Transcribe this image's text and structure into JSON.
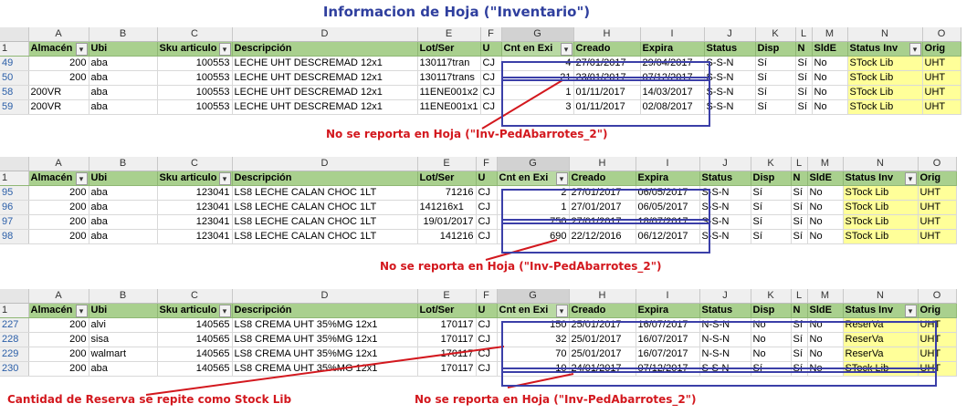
{
  "title": "Informacion de Hoja (\"Inventario\")",
  "column_letters": [
    "A",
    "B",
    "C",
    "D",
    "E",
    "F",
    "G",
    "H",
    "I",
    "J",
    "K",
    "L",
    "M",
    "N",
    "O"
  ],
  "headers": [
    "Almacén",
    "Ubi",
    "Sku articulo",
    "Descripción",
    "Lot/Ser",
    "U",
    "Cnt en Exi",
    "Creado",
    "Expira",
    "Status",
    "Disp",
    "N",
    "SldE",
    "Status Inv",
    "Orig"
  ],
  "headers_variant": [
    "Almacén",
    "Ubi",
    "Sku articulo",
    "Descripción",
    "Lot/Ser",
    "U",
    "Cnt en Exi",
    "Creado",
    "Expira",
    "Status",
    "Disp",
    "N",
    "SldE",
    "Status Inv",
    "Orig"
  ],
  "header_row_number": "1",
  "blocks": [
    {
      "rows": [
        {
          "num": "49",
          "cells": [
            "200",
            "aba",
            "100553",
            "LECHE UHT DESCREMAD 12x1",
            "130117tran",
            "CJ",
            "4",
            "27/01/2017",
            "29/04/2017",
            "S-S-N",
            "Sí",
            "Sí",
            "No",
            "STock Lib",
            "UHT"
          ]
        },
        {
          "num": "50",
          "cells": [
            "200",
            "aba",
            "100553",
            "LECHE UHT DESCREMAD 12x1",
            "130117trans",
            "CJ",
            "21",
            "23/01/2017",
            "07/12/2017",
            "S-S-N",
            "Sí",
            "Sí",
            "No",
            "STock Lib",
            "UHT"
          ]
        },
        {
          "num": "58",
          "cells": [
            "200VR",
            "aba",
            "100553",
            "LECHE UHT DESCREMAD 12x1",
            "11ENE001x2",
            "CJ",
            "1",
            "01/11/2017",
            "14/03/2017",
            "S-S-N",
            "Sí",
            "Sí",
            "No",
            "STock Lib",
            "UHT"
          ]
        },
        {
          "num": "59",
          "cells": [
            "200VR",
            "aba",
            "100553",
            "LECHE UHT DESCREMAD 12x1",
            "11ENE001x1",
            "CJ",
            "3",
            "01/11/2017",
            "02/08/2017",
            "S-S-N",
            "Sí",
            "Sí",
            "No",
            "STock Lib",
            "UHT"
          ]
        }
      ],
      "note": "No se reporta en Hoja (\"Inv-PedAbarrotes_2\")"
    },
    {
      "rows": [
        {
          "num": "95",
          "cells": [
            "200",
            "aba",
            "123041",
            "LS8 LECHE CALAN CHOC 1LT",
            "71216",
            "CJ",
            "2",
            "27/01/2017",
            "06/05/2017",
            "S-S-N",
            "Sí",
            "Sí",
            "No",
            "STock Lib",
            "UHT"
          ]
        },
        {
          "num": "96",
          "cells": [
            "200",
            "aba",
            "123041",
            "LS8 LECHE CALAN CHOC 1LT",
            "141216x1",
            "CJ",
            "1",
            "27/01/2017",
            "06/05/2017",
            "S-S-N",
            "Sí",
            "Sí",
            "No",
            "STock Lib",
            "UHT"
          ]
        },
        {
          "num": "97",
          "cells": [
            "200",
            "aba",
            "123041",
            "LS8 LECHE CALAN CHOC 1LT",
            "19/01/2017",
            "CJ",
            "750",
            "27/01/2017",
            "18/07/2017",
            "S-S-N",
            "Sí",
            "Sí",
            "No",
            "STock Lib",
            "UHT"
          ]
        },
        {
          "num": "98",
          "cells": [
            "200",
            "aba",
            "123041",
            "LS8 LECHE CALAN CHOC 1LT",
            "141216",
            "CJ",
            "690",
            "22/12/2016",
            "06/12/2017",
            "S-S-N",
            "Sí",
            "Sí",
            "No",
            "STock Lib",
            "UHT"
          ]
        }
      ],
      "note": "No se reporta en Hoja (\"Inv-PedAbarrotes_2\")"
    },
    {
      "rows": [
        {
          "num": "227",
          "cells": [
            "200",
            "alvi",
            "140565",
            "LS8 CREMA UHT 35%MG 12x1",
            "170117",
            "CJ",
            "150",
            "25/01/2017",
            "16/07/2017",
            "N-S-N",
            "No",
            "Sí",
            "No",
            "ReserVa",
            "UHT"
          ]
        },
        {
          "num": "228",
          "cells": [
            "200",
            "sisa",
            "140565",
            "LS8 CREMA UHT 35%MG 12x1",
            "170117",
            "CJ",
            "32",
            "25/01/2017",
            "16/07/2017",
            "N-S-N",
            "No",
            "Sí",
            "No",
            "ReserVa",
            "UHT"
          ]
        },
        {
          "num": "229",
          "cells": [
            "200",
            "walmart",
            "140565",
            "LS8 CREMA UHT 35%MG 12x1",
            "170117",
            "CJ",
            "70",
            "25/01/2017",
            "16/07/2017",
            "N-S-N",
            "No",
            "Sí",
            "No",
            "ReserVa",
            "UHT"
          ]
        },
        {
          "num": "230",
          "cells": [
            "200",
            "aba",
            "140565",
            "LS8 CREMA UHT 35%MG 12x1",
            "170117",
            "CJ",
            "10",
            "24/01/2017",
            "07/12/2017",
            "S-S-N",
            "Sí",
            "Sí",
            "No",
            "STock Lib",
            "UHT"
          ]
        }
      ],
      "note": "No se reporta en Hoja (\"Inv-PedAbarrotes_2\")",
      "note2": "Cantidad de Reserva se repite como Stock Lib"
    }
  ],
  "colors": {
    "header_green": "#a9d08e",
    "highlight_yellow": "#ffff99",
    "box_blue": "#3b3fa8",
    "note_red": "#d3181e",
    "title_blue": "#2f3f9e",
    "row_number_blue": "#2a5ea8"
  }
}
